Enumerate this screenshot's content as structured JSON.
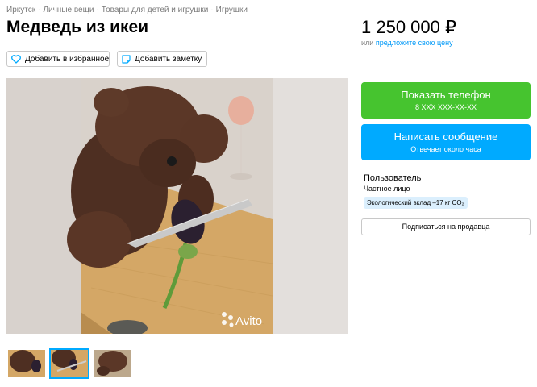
{
  "breadcrumb": {
    "items": [
      "Иркутск",
      "Личные вещи",
      "Товары для детей и игрушки",
      "Игрушки"
    ],
    "separator": "·"
  },
  "listing": {
    "title": "Медведь из икеи"
  },
  "actions": {
    "favorite_label": "Добавить в избранное",
    "note_label": "Добавить заметку"
  },
  "gallery": {
    "watermark": "Avito",
    "thumbnail_count": 3,
    "active_thumbnail": 2
  },
  "price": {
    "value": "1 250 000 ₽",
    "or_text": "или",
    "offer_link": "предложите свою цену"
  },
  "contact": {
    "phone_label": "Показать телефон",
    "phone_masked": "8 XXX XXX-XX-XX",
    "message_label": "Написать сообщение",
    "message_sub": "Отвечает около часа"
  },
  "seller": {
    "name": "Пользователь",
    "type": "Частное лицо",
    "eco_badge": "Экологический вклад –17 кг CO₂",
    "subscribe_label": "Подписаться на продавца"
  },
  "colors": {
    "green": "#46c42f",
    "blue": "#00aaff",
    "link": "#0099f7"
  }
}
